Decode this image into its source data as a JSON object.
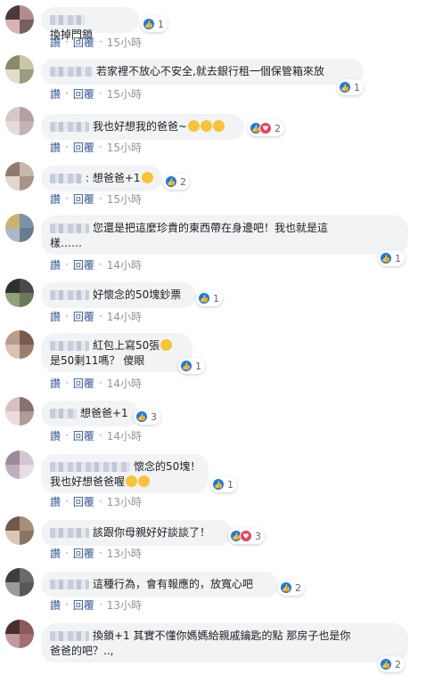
{
  "ui": {
    "reply_label": "回覆",
    "read_label": "讚",
    "dot": "·"
  },
  "comments": [
    {
      "text": "換掉門鎖",
      "like_count": "1",
      "time": "15小時"
    },
    {
      "text": "若家裡不放心不安全,就去銀行租一個保管箱來放",
      "like_count": "1",
      "time": "15小時"
    },
    {
      "text": "我也好想我的爸爸~",
      "like_count": "2",
      "time": "15小時",
      "emojis": [
        "crying-emoji",
        "crying-emoji",
        "crying-emoji"
      ]
    },
    {
      "text": ": 想爸爸+1",
      "like_count": "2",
      "time": "15小時",
      "emojis": [
        "sad-emoji"
      ]
    },
    {
      "text_line1": "您還是把這麼珍貴的東西帶在身邊吧！我也就是這",
      "text_line2": "樣……",
      "like_count": "1",
      "time": "14小時"
    },
    {
      "text": "好懷念的50塊鈔票",
      "like_count": "1",
      "time": "14小時"
    },
    {
      "text_line1": "紅包上寫50張",
      "text_line2": "是50剩11嗎？ 傻眼",
      "like_count": "1",
      "time": "14小時",
      "emojis": [
        "laughing-emoji"
      ]
    },
    {
      "text": "想爸爸+1",
      "like_count": "3",
      "time": "14小時"
    },
    {
      "text_line1": "懷念的50塊！",
      "text_line2": "我也好想爸爸喔",
      "like_count": "1",
      "time": "13小時",
      "emojis": [
        "crying-emoji",
        "crying-emoji"
      ]
    },
    {
      "text": "該跟你母親好好談談了！",
      "like_count": "3",
      "time": "13小時"
    },
    {
      "text": "這種行為，會有報應的，放寬心吧",
      "like_count": "2",
      "time": "13小時"
    },
    {
      "text_line1": "換鎖+1 其實不懂你媽媽給親戚鑰匙的點 那房子也是你",
      "text_line2": "爸爸的吧？..,",
      "like_count": "2",
      "time": "13小時"
    }
  ]
}
